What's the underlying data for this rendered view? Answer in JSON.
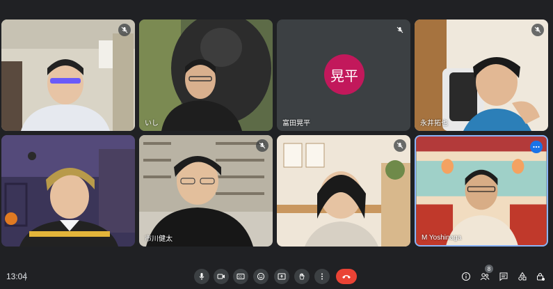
{
  "tiles": [
    {
      "name": "",
      "muted": true
    },
    {
      "name": "いし",
      "muted": false
    },
    {
      "name": "富田晃平",
      "muted": true,
      "avatar_text": "晃平",
      "avatar_color": "#c2185b"
    },
    {
      "name": "永井拓也",
      "muted": true
    },
    {
      "name": "",
      "muted": false
    },
    {
      "name": "市川健太",
      "muted": true
    },
    {
      "name": "",
      "muted": true
    },
    {
      "name": "M Yoshinaga",
      "muted": false,
      "active": true
    }
  ],
  "bottom_bar": {
    "time": "13:04",
    "participant_count": "8",
    "controls": [
      "microphone-icon",
      "camera-icon",
      "captions-icon",
      "emoji-icon",
      "present-icon",
      "raise-hand-icon",
      "more-options-icon",
      "hangup-icon"
    ],
    "right_icons": [
      "info-icon",
      "people-icon",
      "chat-icon",
      "activities-icon",
      "host-controls-icon"
    ]
  },
  "colors": {
    "background": "#202124",
    "tile": "#3c4043",
    "active_border": "#8ab4f8",
    "hangup": "#ea4335"
  }
}
